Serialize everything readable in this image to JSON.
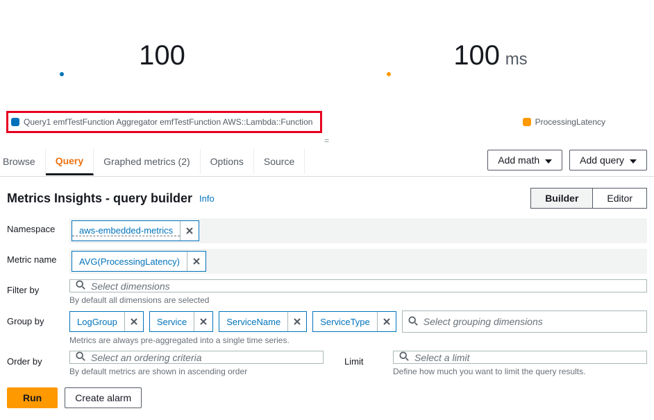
{
  "metrics": {
    "left": {
      "value": "100",
      "unit": ""
    },
    "right": {
      "value": "100",
      "unit": "ms"
    }
  },
  "legend": {
    "left": "Query1 emfTestFunction Aggregator emfTestFunction AWS::Lambda::Function",
    "right": "ProcessingLatency"
  },
  "tabs": {
    "browse": "Browse",
    "query": "Query",
    "graphed": "Graphed metrics (2)",
    "options": "Options",
    "source": "Source"
  },
  "actions": {
    "add_math": "Add math",
    "add_query": "Add query"
  },
  "builder": {
    "title": "Metrics Insights - query builder",
    "info": "Info",
    "seg_builder": "Builder",
    "seg_editor": "Editor"
  },
  "rows": {
    "namespace_label": "Namespace",
    "namespace_chip": "aws-embedded-metrics",
    "metric_label": "Metric name",
    "metric_chip": "AVG(ProcessingLatency)",
    "filter_label": "Filter by",
    "filter_placeholder": "Select dimensions",
    "filter_hint": "By default all dimensions are selected",
    "group_label": "Group by",
    "group_chips": [
      "LogGroup",
      "Service",
      "ServiceName",
      "ServiceType"
    ],
    "group_placeholder": "Select grouping dimensions",
    "group_hint": "Metrics are always pre-aggregated into a single time series.",
    "order_label": "Order by",
    "order_placeholder": "Select an ordering criteria",
    "order_hint": "By default metrics are shown in ascending order",
    "limit_label": "Limit",
    "limit_placeholder": "Select a limit",
    "limit_hint": "Define how much you want to limit the query results."
  },
  "footer": {
    "run": "Run",
    "alarm": "Create alarm"
  },
  "chart_data": [
    {
      "type": "singlestat",
      "title": "Query1 emfTestFunction Aggregator emfTestFunction AWS::Lambda::Function",
      "value": 100,
      "unit": ""
    },
    {
      "type": "singlestat",
      "title": "ProcessingLatency",
      "value": 100,
      "unit": "ms"
    }
  ]
}
